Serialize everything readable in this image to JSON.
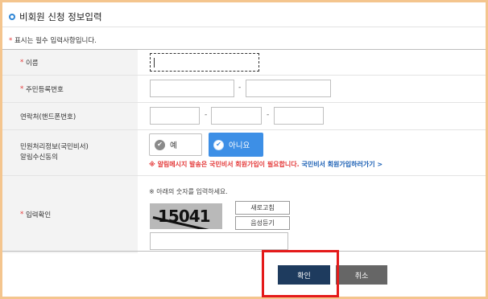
{
  "header": {
    "title": "비회원 신청 정보입력"
  },
  "notice": {
    "star": "*",
    "text": " 표시는 필수 입력사항입니다."
  },
  "fields": {
    "name": {
      "label": "이름"
    },
    "rrn": {
      "label": "주민등록번호",
      "sep": "-"
    },
    "phone": {
      "label": "연락처(핸드폰번호)",
      "sep1": "-",
      "sep2": "-"
    },
    "consent": {
      "label_line1": "민원처리정보(국민비서)",
      "label_line2": "알림수신동의",
      "yes": "예",
      "no": "아니요",
      "alert": "※ 알림메시지 발송은 국민비서 회원가입이 필요합니다.",
      "link": "국민비서 회원가입하러가기 >"
    },
    "captcha": {
      "label": "입력확인",
      "instruction": "※ 아래의 숫자를 입력하세요.",
      "image_text": "15041",
      "refresh": "새로고침",
      "audio": "음성듣기"
    }
  },
  "star": "*",
  "buttons": {
    "confirm": "확인",
    "cancel": "취소"
  }
}
